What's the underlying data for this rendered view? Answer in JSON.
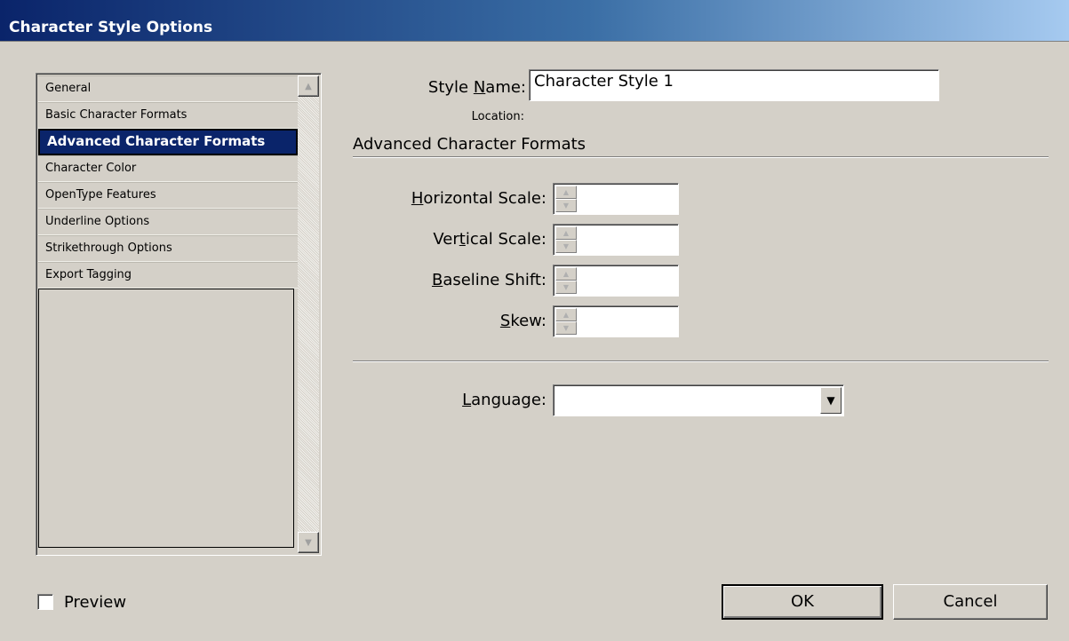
{
  "window": {
    "title": "Character Style Options"
  },
  "categories": [
    {
      "label": "General"
    },
    {
      "label": "Basic Character Formats"
    },
    {
      "label": "Advanced Character Formats",
      "selected": true
    },
    {
      "label": "Character Color"
    },
    {
      "label": "OpenType Features"
    },
    {
      "label": "Underline Options"
    },
    {
      "label": "Strikethrough Options"
    },
    {
      "label": "Export Tagging"
    }
  ],
  "style_name": {
    "label_pre": "Style ",
    "label_key": "N",
    "label_post": "ame:",
    "value": "Character Style 1"
  },
  "location": {
    "label": "Location:"
  },
  "section": {
    "title": "Advanced Character Formats"
  },
  "fields": {
    "horizontal_scale": {
      "label_key": "H",
      "label_post": "orizontal Scale:",
      "value": ""
    },
    "vertical_scale": {
      "label_pre": "Ver",
      "label_key": "t",
      "label_post": "ical Scale:",
      "value": ""
    },
    "baseline_shift": {
      "label_key": "B",
      "label_post": "aseline Shift:",
      "value": ""
    },
    "skew": {
      "label_key": "S",
      "label_post": "kew:",
      "value": ""
    }
  },
  "language": {
    "label_key": "L",
    "label_post": "anguage:",
    "value": ""
  },
  "preview": {
    "label": "Preview",
    "checked": false
  },
  "buttons": {
    "ok": "OK",
    "cancel": "Cancel"
  },
  "colors": {
    "title_bar_start": "#0a246a",
    "title_bar_end": "#a6caf0",
    "selection": "#0a246a",
    "dialog_bg": "#d4d0c8"
  }
}
